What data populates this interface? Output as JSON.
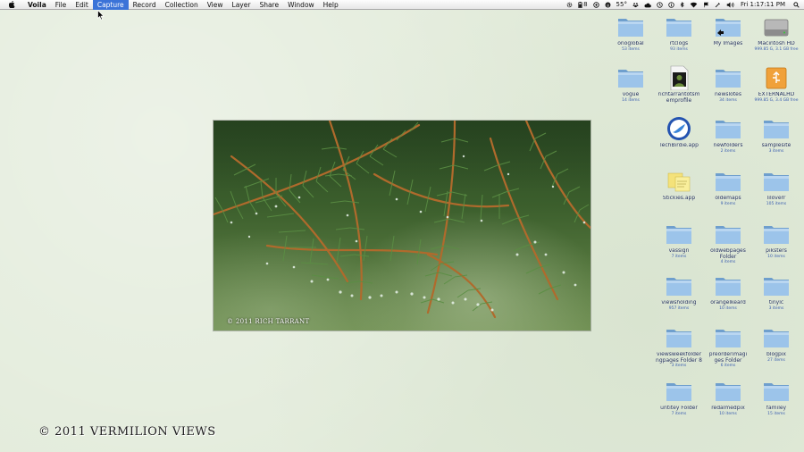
{
  "menubar": {
    "app": "Voila",
    "items": [
      "File",
      "Edit",
      "Capture",
      "Record",
      "Collection",
      "View",
      "Layer",
      "Share",
      "Window",
      "Help"
    ],
    "active": "Capture",
    "status": {
      "battery_count": "8",
      "temperature": "55°",
      "clock": "Fri 1:17:11 PM"
    }
  },
  "photo": {
    "caption": "© 2011 RICH TARRANT"
  },
  "watermark": "© 2011 VERMILION VIEWS",
  "desktop_icons": [
    {
      "id": "c1r1",
      "type": "folder",
      "label": "onoglobal",
      "sub": "53 items"
    },
    {
      "id": "c2r1",
      "type": "folder",
      "label": "rtclogs",
      "sub": "93 items"
    },
    {
      "id": "c3r1",
      "type": "folder-alias",
      "label": "My Images",
      "sub": ""
    },
    {
      "id": "c4r1",
      "type": "harddrive",
      "label": "Macintosh HD",
      "sub": "999.85 G, 3.1 GB free"
    },
    {
      "id": "c1r2",
      "type": "folder",
      "label": "vogue",
      "sub": "14 items"
    },
    {
      "id": "c2r2",
      "type": "profile",
      "label": "richtarrantotsm emprofile",
      "sub": ""
    },
    {
      "id": "c3r2",
      "type": "folder",
      "label": "newslotes",
      "sub": "34 items"
    },
    {
      "id": "c4r2",
      "type": "usb",
      "label": "EXTERNALHD",
      "sub": "999.85 G, 3.4 GB free"
    },
    {
      "id": "c2r3",
      "type": "app-bird",
      "label": "TechBirdie.app",
      "sub": ""
    },
    {
      "id": "c3r3",
      "type": "folder",
      "label": "newfolders",
      "sub": "2 items"
    },
    {
      "id": "c4r3",
      "type": "folder",
      "label": "samplesite",
      "sub": "3 items"
    },
    {
      "id": "c2r4",
      "type": "app-stickies",
      "label": "Stickies.app",
      "sub": ""
    },
    {
      "id": "c3r4",
      "type": "folder",
      "label": "oldemaps",
      "sub": "9 items"
    },
    {
      "id": "c4r4",
      "type": "folder",
      "label": "liloverr",
      "sub": "105 items"
    },
    {
      "id": "c2r5",
      "type": "folder",
      "label": "vassign",
      "sub": "7 items"
    },
    {
      "id": "c3r5",
      "type": "folder",
      "label": "oldwebpages Folder",
      "sub": "4 items"
    },
    {
      "id": "c4r5",
      "type": "folder",
      "label": "piksters",
      "sub": "10 items"
    },
    {
      "id": "c2r6",
      "type": "folder",
      "label": "viewsholding",
      "sub": "957 items"
    },
    {
      "id": "c3r6",
      "type": "folder",
      "label": "orangelkeard",
      "sub": "10 items"
    },
    {
      "id": "c4r6",
      "type": "folder",
      "label": "tinylc",
      "sub": "3 items"
    },
    {
      "id": "c2r7",
      "type": "folder",
      "label": "viewsweekfolder ngpages Folder 8",
      "sub": "3 items"
    },
    {
      "id": "c3r7",
      "type": "folder",
      "label": "preorderimagi ges Folder",
      "sub": "6 items"
    },
    {
      "id": "c4r7",
      "type": "folder",
      "label": "blogpix",
      "sub": "27 items"
    },
    {
      "id": "c2r8",
      "type": "folder",
      "label": "untitey Folder",
      "sub": "7 items"
    },
    {
      "id": "c3r8",
      "type": "folder",
      "label": "redalmedpix",
      "sub": "10 items"
    },
    {
      "id": "c4r8",
      "type": "folder",
      "label": "familey",
      "sub": "15 items"
    }
  ],
  "colors": {
    "desktop_bg": "#e2ebda",
    "menu_highlight": "#3b73d8",
    "folder_blue": "#8ab6e0",
    "label_blue": "#1b2a55"
  }
}
